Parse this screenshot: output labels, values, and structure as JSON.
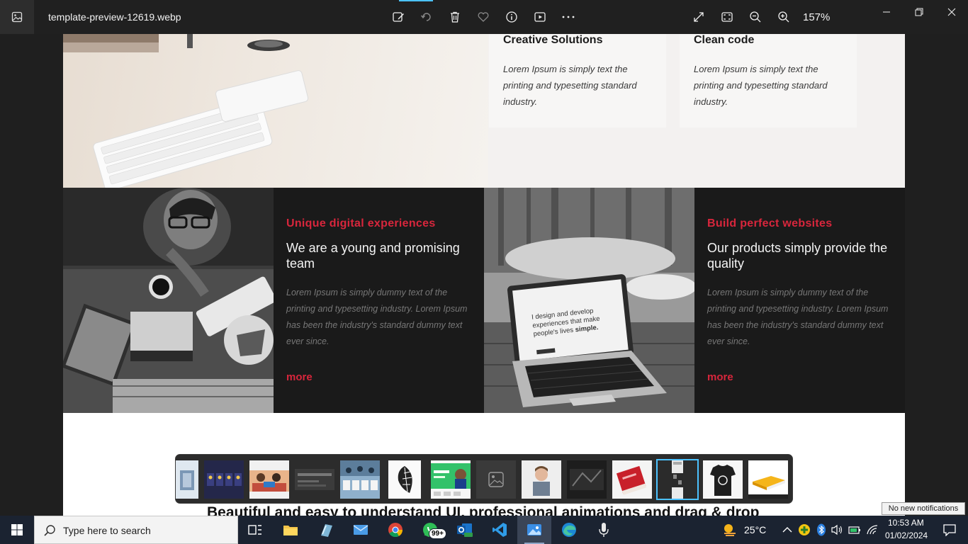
{
  "window": {
    "file_name": "template-preview-12619.webp",
    "zoom": "157%",
    "toolbar_icons": [
      "edit-image-icon",
      "rotate-icon",
      "delete-icon",
      "favorite-icon",
      "info-icon",
      "slideshow-icon",
      "more-icon"
    ],
    "view_icons": [
      "full-screen-icon",
      "fit-window-icon",
      "zoom-out-icon",
      "zoom-in-icon"
    ]
  },
  "webpage": {
    "features": [
      {
        "title": "Creative Solutions",
        "text": "Lorem Ipsum is simply text the printing and typesetting standard industry."
      },
      {
        "title": "Clean code",
        "text": "Lorem Ipsum is simply text the printing and typesetting standard industry."
      }
    ],
    "panels": [
      {
        "kicker": "Unique digital experiences",
        "heading": "We are a young and promising team",
        "body": "Lorem Ipsum is simply dummy text of the printing and typesetting industry. Lorem Ipsum has been the industry's standard dummy text ever since.",
        "more": "more"
      },
      {
        "kicker": "Build perfect websites",
        "heading": "Our products simply provide the quality",
        "body": "Lorem Ipsum is simply dummy text of the printing and typesetting industry. Lorem Ipsum has been the industry's standard dummy text ever since.",
        "more": "more"
      }
    ],
    "laptop_screen_text": "I design and develop experiences that make people's lives simple.",
    "bottom_heading": "Beautiful and easy to understand UI, professional animations and drag & drop"
  },
  "filmstrip": {
    "selected_index": 11,
    "count": 14
  },
  "taskbar": {
    "search_placeholder": "Type here to search",
    "mail_badge": "99+",
    "weather": "25°C",
    "time": "10:53 AM",
    "date": "01/02/2024",
    "notification_tooltip": "No new notifications"
  },
  "colors": {
    "accent": "#d8263c",
    "selection": "#4cc2ff",
    "taskbar": "#1b2331"
  }
}
